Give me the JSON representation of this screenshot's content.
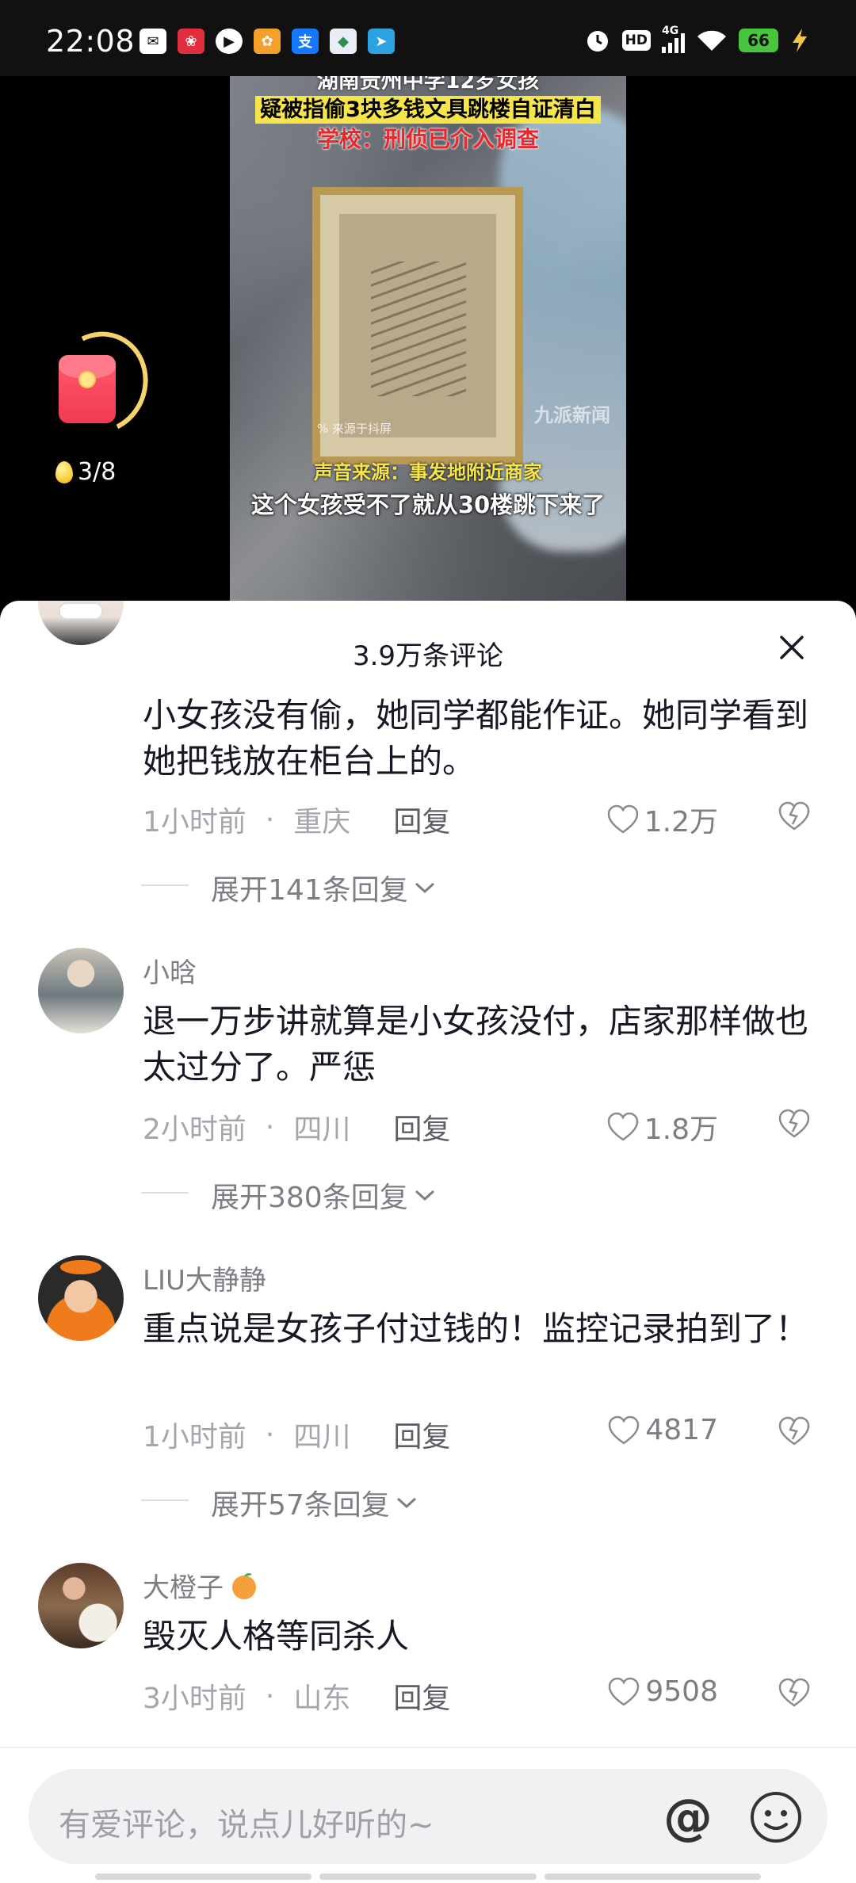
{
  "status_bar": {
    "time": "22:08",
    "notification_icons": [
      "mail-icon",
      "shopping-icon",
      "video-play-icon",
      "pet-app-icon",
      "alipay-icon",
      "app-icon",
      "telegram-icon"
    ],
    "system_icons": [
      "alarm-icon",
      "hd-icon",
      "4g-signal-icon",
      "wifi-icon",
      "battery-icon",
      "charging-icon"
    ],
    "network": "4G",
    "hd": "HD",
    "battery": "66"
  },
  "video": {
    "caption_line1": "湖南贵州中学12岁女孩",
    "caption_line2": "疑被指偷3块多钱文具跳楼自证清白",
    "caption_line3": "学校：刑侦已介入调查",
    "watermark": "% 来源于抖屏",
    "logo": "九派新闻",
    "source_caption": "声音来源：事发地附近商家",
    "subtitle": "这个女孩受不了就从30楼跳下来了"
  },
  "task_widget": {
    "progress": "3/8",
    "progress_value": 0.375
  },
  "comments_panel": {
    "title": "3.9万条评论",
    "comments": [
      {
        "username": "",
        "text": "小女孩没有偷，她同学都能作证。她同学看到她把钱放在柜台上的。",
        "time": "1小时前",
        "location": "重庆",
        "reply_label": "回复",
        "likes": "1.2万",
        "expand_label": "展开141条回复"
      },
      {
        "username": "小晗",
        "text": "退一万步讲就算是小女孩没付，店家那样做也太过分了。严惩",
        "time": "2小时前",
        "location": "四川",
        "reply_label": "回复",
        "likes": "1.8万",
        "expand_label": "展开380条回复"
      },
      {
        "username": "LIU大静静",
        "text": "重点说是女孩子付过钱的！监控记录拍到了！",
        "time": "1小时前",
        "location": "四川",
        "reply_label": "回复",
        "likes": "4817",
        "expand_label": "展开57条回复"
      },
      {
        "username": "大橙子",
        "text": "毁灭人格等同杀人",
        "time": "3小时前",
        "location": "山东",
        "reply_label": "回复",
        "likes": "9508",
        "expand_label": ""
      }
    ],
    "dot": "·"
  },
  "input": {
    "placeholder": "有爱评论，说点儿好听的~",
    "at_label": "@"
  },
  "colors": {
    "accent_yellow": "#f5e44a",
    "caption_red": "#e8272b",
    "text_primary": "#161823",
    "text_secondary": "#a5a6ab"
  }
}
